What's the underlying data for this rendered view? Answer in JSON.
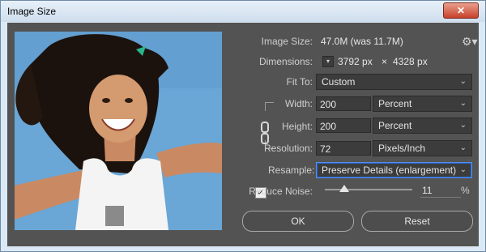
{
  "window": {
    "title": "Image Size",
    "close_glyph": "✕"
  },
  "image_size": {
    "label": "Image Size:",
    "value": "47.0M (was 11.7M)"
  },
  "dimensions": {
    "label": "Dimensions:",
    "width": "3792 px",
    "times": "×",
    "height": "4328 px"
  },
  "fit_to": {
    "label": "Fit To:",
    "value": "Custom"
  },
  "width": {
    "label": "Width:",
    "value": "200",
    "unit": "Percent"
  },
  "height": {
    "label": "Height:",
    "value": "200",
    "unit": "Percent"
  },
  "resolution": {
    "label": "Resolution:",
    "value": "72",
    "unit": "Pixels/Inch"
  },
  "resample": {
    "label": "Resample:",
    "checked": true,
    "check_glyph": "✓",
    "value": "Preserve Details (enlargement)"
  },
  "reduce_noise": {
    "label": "Reduce Noise:",
    "value": "11",
    "unit": "%",
    "level_percent": 11
  },
  "buttons": {
    "ok": "OK",
    "reset": "Reset"
  },
  "icons": {
    "gear": "gear-icon",
    "chevron": "chevron-down-icon",
    "link": "link-icon"
  },
  "colors": {
    "panel": "#535353",
    "field": "#3c3c3c",
    "accent": "#4f8ff0",
    "sky": "#6aa6d6"
  }
}
